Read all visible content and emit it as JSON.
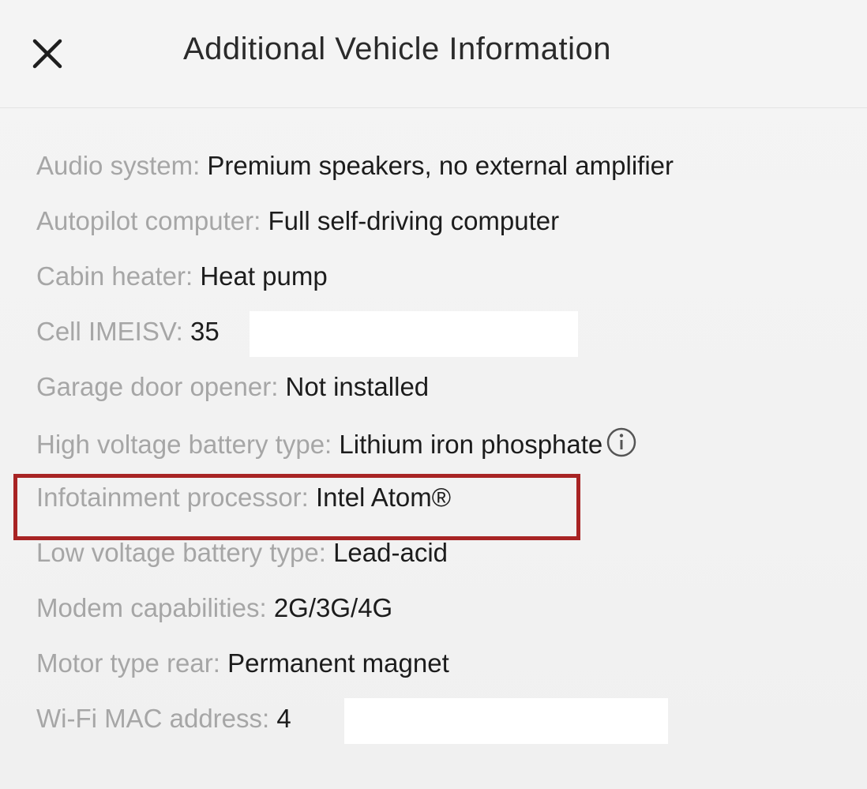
{
  "header": {
    "title": "Additional Vehicle Information",
    "close_icon": "close-icon"
  },
  "rows": [
    {
      "label": "Audio system: ",
      "value": "Premium speakers, no external amplifier"
    },
    {
      "label": "Autopilot computer: ",
      "value": "Full self-driving computer"
    },
    {
      "label": "Cabin heater: ",
      "value": "Heat pump"
    },
    {
      "label": "Cell IMEISV: ",
      "value": "35",
      "redacted": true
    },
    {
      "label": "Garage door opener: ",
      "value": "Not installed"
    },
    {
      "label": "High voltage battery type: ",
      "value": "Lithium iron phosphate",
      "icon": "info-icon"
    },
    {
      "label": "Infotainment processor: ",
      "value": "Intel Atom®",
      "highlighted": true
    },
    {
      "label": "Low voltage battery type: ",
      "value": "Lead-acid"
    },
    {
      "label": "Modem capabilities: ",
      "value": "2G/3G/4G"
    },
    {
      "label": "Motor type rear: ",
      "value": "Permanent magnet"
    },
    {
      "label": "Wi-Fi MAC address: ",
      "value": "4",
      "redacted": true
    }
  ],
  "colors": {
    "label": "#a6a6a6",
    "value": "#1c1c1c",
    "highlight_border": "#a82424",
    "background": "#f3f3f3"
  }
}
